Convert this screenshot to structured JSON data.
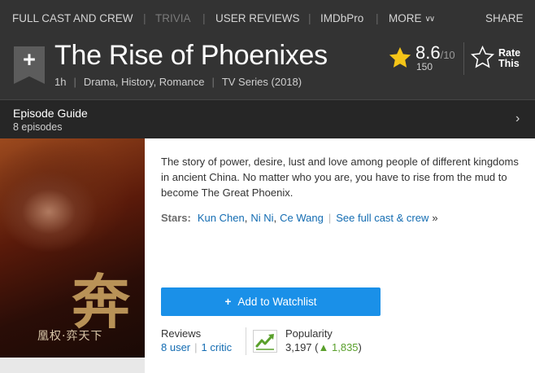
{
  "nav": {
    "full_cast": "FULL CAST AND CREW",
    "trivia": "TRIVIA",
    "user_reviews": "USER REVIEWS",
    "imdbpro": "IMDbPro",
    "more": "MORE",
    "share": "SHARE",
    "separator": "|"
  },
  "title": {
    "watchlist_ribbon_icon": "plus-ribbon-icon",
    "ribbon_symbol": "+",
    "name": "The Rise of Phoenixes",
    "runtime": "1h",
    "genres": "Drama, History, Romance",
    "type": "TV Series (2018)"
  },
  "rating": {
    "value": "8.6",
    "max": "/10",
    "count": "150",
    "rate_line1": "Rate",
    "rate_line2": "This",
    "star_color": "#f5c518"
  },
  "episode_guide": {
    "title": "Episode Guide",
    "count": "8 episodes",
    "chevron": "›"
  },
  "poster": {
    "glyph": "奔",
    "caption": "凰权·弈天下"
  },
  "plot": "The story of power, desire, lust and love among people of different kingdoms in ancient China. No matter who you are, you have to rise from the mud to become The Great Phoenix.",
  "stars": {
    "label": "Stars:",
    "names": [
      "Kun Chen",
      "Ni Ni",
      "Ce Wang"
    ],
    "see_full": "See full cast & crew",
    "raquo": "»"
  },
  "watchlist": {
    "plus": "+",
    "label": "Add to Watchlist",
    "color": "#1a90e8"
  },
  "reviews": {
    "label": "Reviews",
    "user": "8 user",
    "critic": "1 critic"
  },
  "popularity": {
    "label": "Popularity",
    "value": "3,197",
    "change": "1,835",
    "trend_icon": "trend-up-icon"
  }
}
